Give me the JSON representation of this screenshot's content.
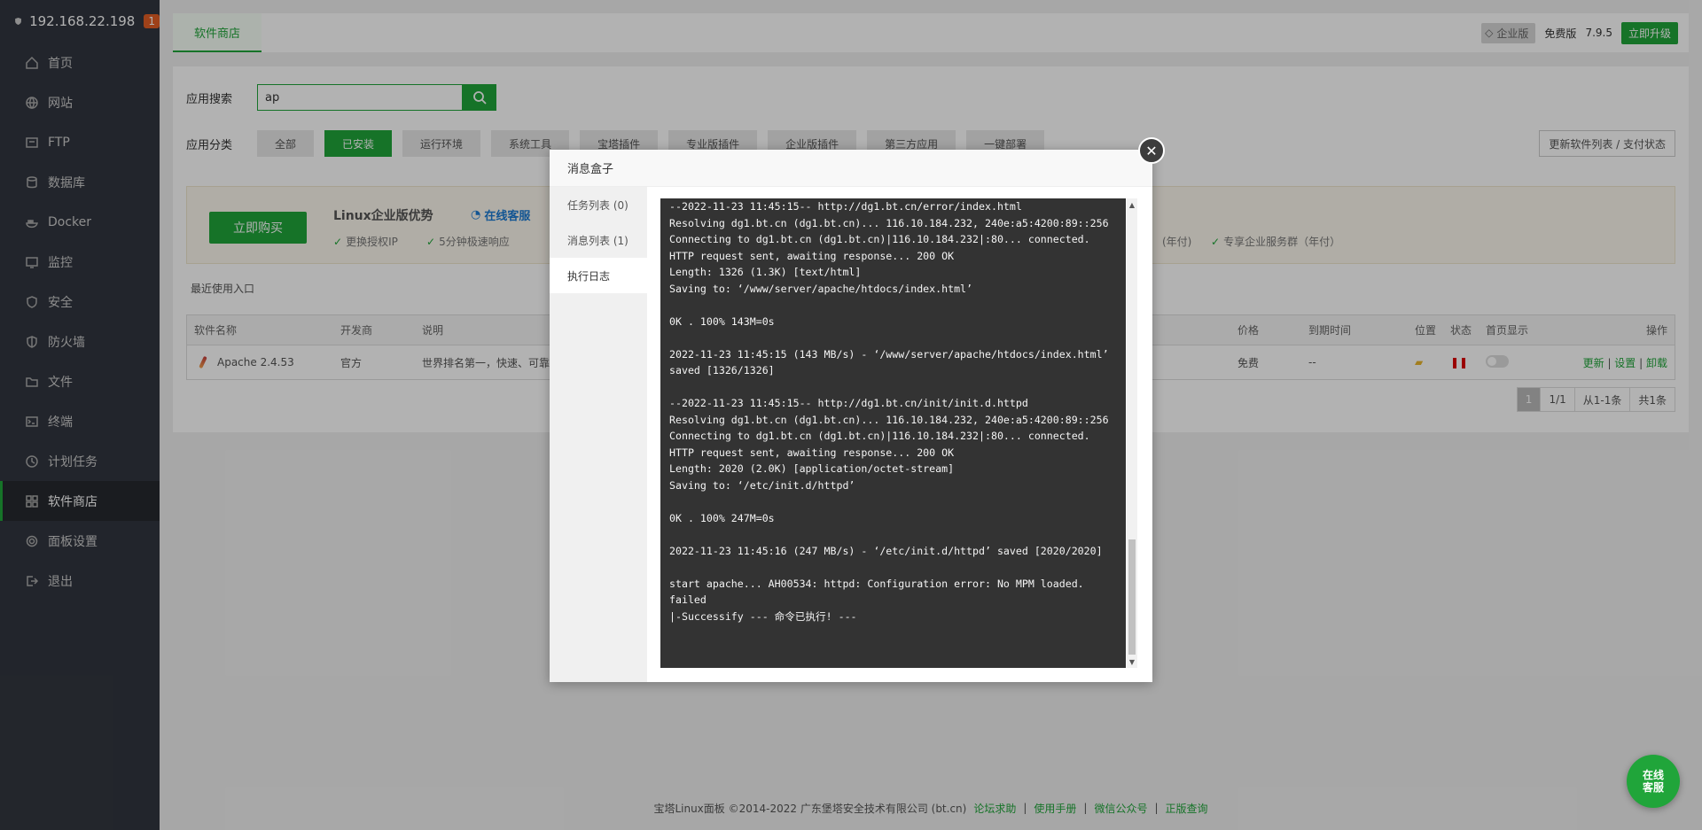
{
  "sidebar": {
    "host": "192.168.22.198",
    "badge": "1",
    "items": [
      {
        "label": "首页",
        "icon": "home-icon"
      },
      {
        "label": "网站",
        "icon": "globe-icon"
      },
      {
        "label": "FTP",
        "icon": "ftp-icon"
      },
      {
        "label": "数据库",
        "icon": "database-icon"
      },
      {
        "label": "Docker",
        "icon": "docker-icon"
      },
      {
        "label": "监控",
        "icon": "monitor-icon"
      },
      {
        "label": "安全",
        "icon": "shield-icon"
      },
      {
        "label": "防火墙",
        "icon": "firewall-icon"
      },
      {
        "label": "文件",
        "icon": "folder-icon"
      },
      {
        "label": "终端",
        "icon": "terminal-icon"
      },
      {
        "label": "计划任务",
        "icon": "clock-icon"
      },
      {
        "label": "软件商店",
        "icon": "grid-icon",
        "active": true
      },
      {
        "label": "面板设置",
        "icon": "gear-icon"
      },
      {
        "label": "退出",
        "icon": "logout-icon"
      }
    ]
  },
  "topbar": {
    "tab": "软件商店",
    "edition_badge": "企业版",
    "free_label": "免费版",
    "version": "7.9.5",
    "upgrade": "立即升级"
  },
  "search": {
    "label": "应用搜索",
    "value": "ap"
  },
  "categories": {
    "label": "应用分类",
    "items": [
      "全部",
      "已安装",
      "运行环境",
      "系统工具",
      "宝塔插件",
      "专业版插件",
      "企业版插件",
      "第三方应用",
      "一键部署"
    ],
    "refresh": "更新软件列表 / 支付状态"
  },
  "promo": {
    "buy": "立即购买",
    "title": "Linux企业版优势",
    "service": "在线客服",
    "features": [
      "更换授权IP",
      "5分钟极速响应",
      "(年付)",
      "专享企业服务群（年付）"
    ]
  },
  "recent": "最近使用入口",
  "table": {
    "headers": [
      "软件名称",
      "开发商",
      "说明",
      "价格",
      "到期时间",
      "位置",
      "状态",
      "首页显示",
      "操作"
    ],
    "row": {
      "name": "Apache 2.4.53",
      "vendor": "官方",
      "desc": "世界排名第一，快速、可靠",
      "price": "免费",
      "expire": "--",
      "ops": [
        "更新",
        "设置",
        "卸载"
      ]
    }
  },
  "pager": [
    "1",
    "1/1",
    "从1-1条",
    "共1条"
  ],
  "footer": {
    "copyright": "宝塔Linux面板 ©2014-2022 广东堡塔安全技术有限公司 (bt.cn)",
    "links": [
      "论坛求助",
      "使用手册",
      "微信公众号",
      "正版查询"
    ]
  },
  "chat": "在线客服",
  "modal": {
    "title": "消息盒子",
    "tabs": [
      "任务列表 (0)",
      "消息列表 (1)",
      "执行日志"
    ],
    "log": [
      "--2022-11-23 11:45:15-- http://dg1.bt.cn/error/index.html",
      "Resolving dg1.bt.cn (dg1.bt.cn)... 116.10.184.232, 240e:a5:4200:89::256",
      "Connecting to dg1.bt.cn (dg1.bt.cn)|116.10.184.232|:80... connected.",
      "HTTP request sent, awaiting response... 200 OK",
      "Length: 1326 (1.3K) [text/html]",
      "Saving to: ‘/www/server/apache/htdocs/index.html’",
      "",
      "0K . 100% 143M=0s",
      "",
      "2022-11-23 11:45:15 (143 MB/s) - ‘/www/server/apache/htdocs/index.html’ saved [1326/1326]",
      "",
      "--2022-11-23 11:45:15-- http://dg1.bt.cn/init/init.d.httpd",
      "Resolving dg1.bt.cn (dg1.bt.cn)... 116.10.184.232, 240e:a5:4200:89::256",
      "Connecting to dg1.bt.cn (dg1.bt.cn)|116.10.184.232|:80... connected.",
      "HTTP request sent, awaiting response... 200 OK",
      "Length: 2020 (2.0K) [application/octet-stream]",
      "Saving to: ‘/etc/init.d/httpd’",
      "",
      "0K . 100% 247M=0s",
      "",
      "2022-11-23 11:45:16 (247 MB/s) - ‘/etc/init.d/httpd’ saved [2020/2020]",
      "",
      "start apache... AH00534: httpd: Configuration error: No MPM loaded.",
      "failed",
      "|-Successify --- 命令已执行! ---"
    ]
  }
}
